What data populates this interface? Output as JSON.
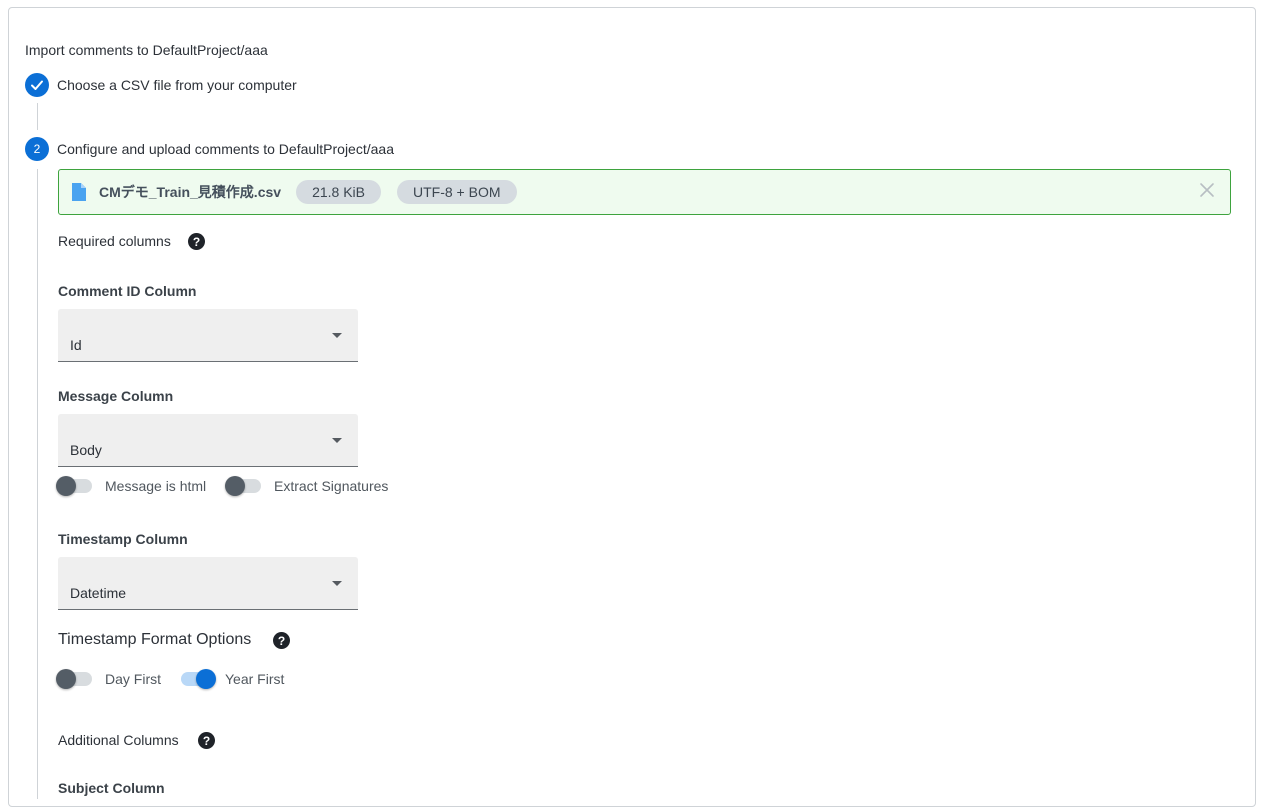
{
  "header": {
    "title": "Import comments to DefaultProject/aaa"
  },
  "steps": [
    {
      "number": "1",
      "label": "Choose a CSV file from your computer",
      "status": "done"
    },
    {
      "number": "2",
      "label": "Configure and upload comments to DefaultProject/aaa",
      "status": "active"
    }
  ],
  "file": {
    "name": "CMデモ_Train_見積作成.csv",
    "size": "21.8 KiB",
    "encoding": "UTF-8 + BOM",
    "icon": "file-icon",
    "close_icon": "close-icon"
  },
  "required": {
    "title": "Required columns",
    "help": "?",
    "comment_id": {
      "label": "Comment ID Column",
      "value": "Id"
    },
    "message": {
      "label": "Message Column",
      "value": "Body"
    },
    "toggles": {
      "message_is_html": {
        "label": "Message is html",
        "on": false
      },
      "extract_signatures": {
        "label": "Extract Signatures",
        "on": false
      }
    },
    "timestamp": {
      "label": "Timestamp Column",
      "value": "Datetime"
    }
  },
  "timestamp_format": {
    "title": "Timestamp Format Options",
    "help": "?",
    "day_first": {
      "label": "Day First",
      "on": false
    },
    "year_first": {
      "label": "Year First",
      "on": true
    }
  },
  "additional": {
    "title": "Additional Columns",
    "help": "?",
    "subject_label": "Subject Column"
  },
  "colors": {
    "accent": "#0b6fd6",
    "success_border": "#3ea33e",
    "success_bg": "#effbef"
  }
}
